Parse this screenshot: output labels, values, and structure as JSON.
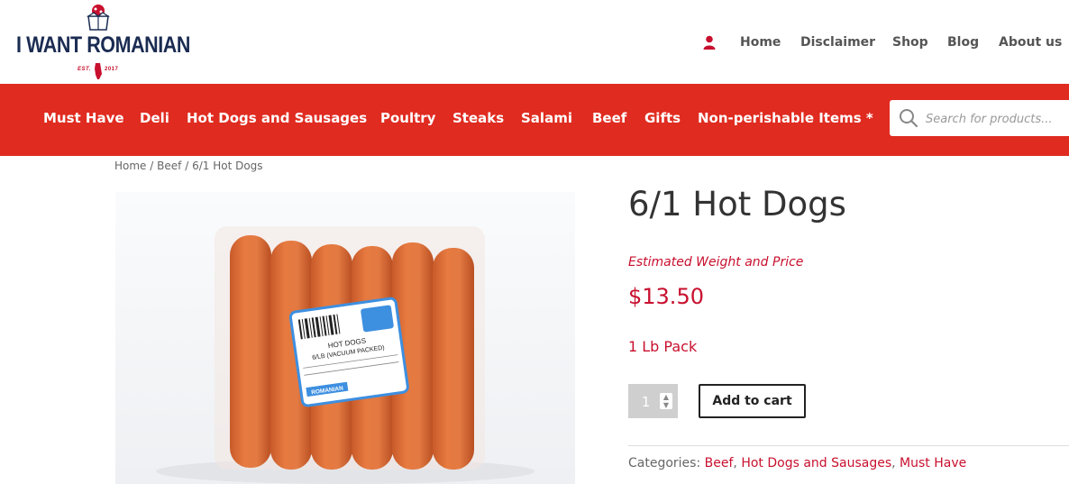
{
  "logo": {
    "text": "I WANT ROMANIAN",
    "est": "EST.",
    "year": "2017"
  },
  "topnav": {
    "items": [
      "Home",
      "Disclaimer",
      "Shop",
      "Blog",
      "About us"
    ]
  },
  "catnav": {
    "items": [
      "Must Have",
      "Deli",
      "Hot Dogs and Sausages",
      "Poultry",
      "Steaks",
      "Salami",
      "Beef",
      "Gifts",
      "Non-perishable Items *"
    ]
  },
  "search": {
    "placeholder": "Search for products..."
  },
  "breadcrumb": {
    "home": "Home",
    "beef": "Beef",
    "current": "6/1 Hot Dogs",
    "sep": "/"
  },
  "product": {
    "title": "6/1 Hot Dogs",
    "estimated": "Estimated Weight and Price",
    "price": "$13.50",
    "pack": "1 Lb Pack",
    "quantity": "1",
    "add_to_cart": "Add to cart",
    "categories_label": "Categories:",
    "categories": [
      "Beef",
      "Hot Dogs and Sausages",
      "Must Have"
    ]
  },
  "package_label": {
    "line1": "HOT DOGS",
    "line2": "6/LB (VACUUM PACKED)",
    "brand": "ROMANIAN"
  },
  "colors": {
    "brand_red": "#e02b20",
    "accent_red": "#c8102e",
    "navy": "#1b2c52"
  }
}
